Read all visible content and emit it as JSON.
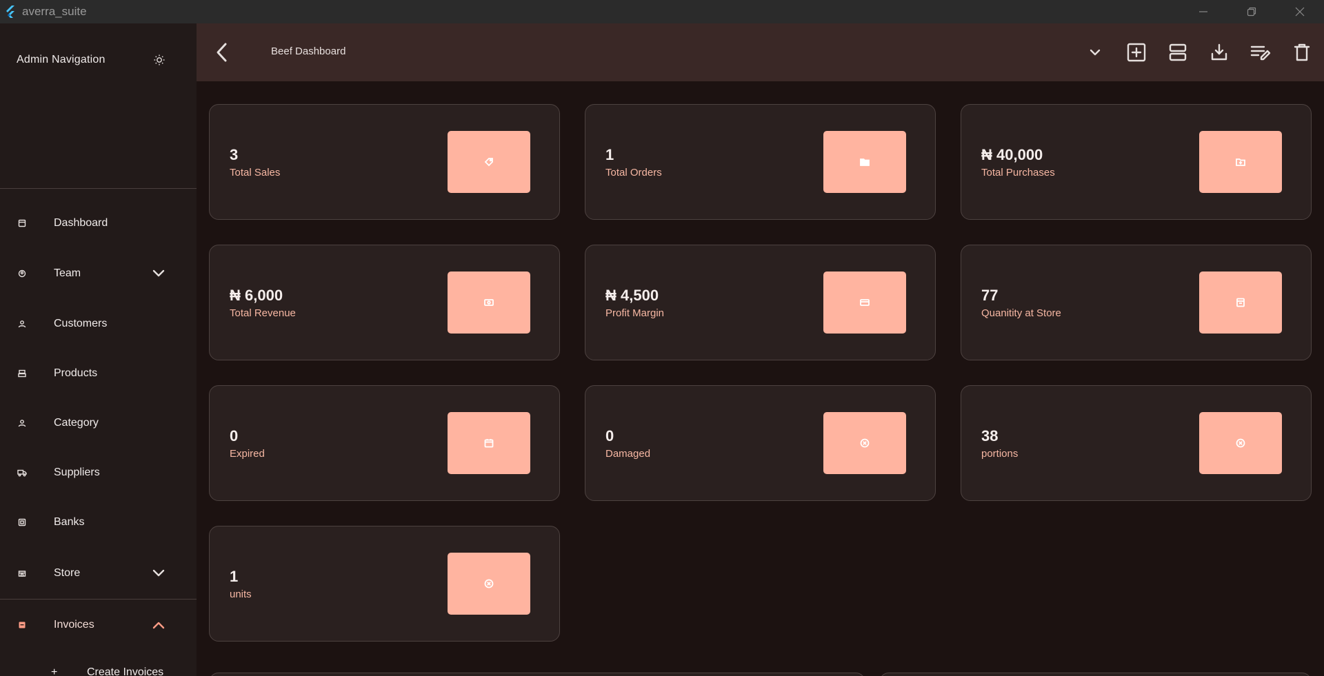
{
  "window": {
    "title": "averra_suite"
  },
  "sidebar": {
    "title": "Admin Navigation",
    "items": [
      {
        "label": "Dashboard",
        "icon": "dashboard-icon"
      },
      {
        "label": "Team",
        "icon": "team-icon",
        "expandable": true
      },
      {
        "label": "Customers",
        "icon": "person-icon"
      },
      {
        "label": "Products",
        "icon": "products-icon"
      },
      {
        "label": "Category",
        "icon": "category-icon"
      },
      {
        "label": "Suppliers",
        "icon": "truck-icon"
      },
      {
        "label": "Banks",
        "icon": "bank-icon"
      },
      {
        "label": "Store",
        "icon": "store-icon",
        "expandable": true
      },
      {
        "label": "Invoices",
        "icon": "invoice-icon",
        "expanded": true
      }
    ],
    "sub_items": [
      {
        "label": "Create Invoices",
        "prefix": "+"
      }
    ]
  },
  "appbar": {
    "title": "Beef Dashboard",
    "actions": [
      "chevron-down-icon",
      "add-box-icon",
      "view-agenda-icon",
      "download-icon",
      "edit-list-icon",
      "delete-icon"
    ]
  },
  "cards": [
    {
      "value": "3",
      "label": "Total Sales",
      "icon": "tag-icon"
    },
    {
      "value": "1",
      "label": "Total Orders",
      "icon": "folder-icon"
    },
    {
      "value": "₦ 40,000",
      "label": "Total Purchases",
      "icon": "folder-add-icon"
    },
    {
      "value": "₦ 6,000",
      "label": "Total Revenue",
      "icon": "money-icon"
    },
    {
      "value": "₦ 4,500",
      "label": "Profit Margin",
      "icon": "card-icon"
    },
    {
      "value": "77",
      "label": "Quanitity at Store",
      "icon": "store-box-icon"
    },
    {
      "value": "0",
      "label": "Expired",
      "icon": "calendar-icon"
    },
    {
      "value": "0",
      "label": "Damaged",
      "icon": "cancel-circle-icon"
    },
    {
      "value": "38",
      "label": "portions",
      "icon": "cancel-circle-icon"
    },
    {
      "value": "1",
      "label": "units",
      "icon": "cancel-circle-icon"
    }
  ],
  "colors": {
    "accent": "#ffb4a0",
    "label": "#f6b7a3",
    "background": "#1c1211",
    "card": "#2a201f",
    "appbar": "#3a2826",
    "sidebar": "#221a19"
  }
}
